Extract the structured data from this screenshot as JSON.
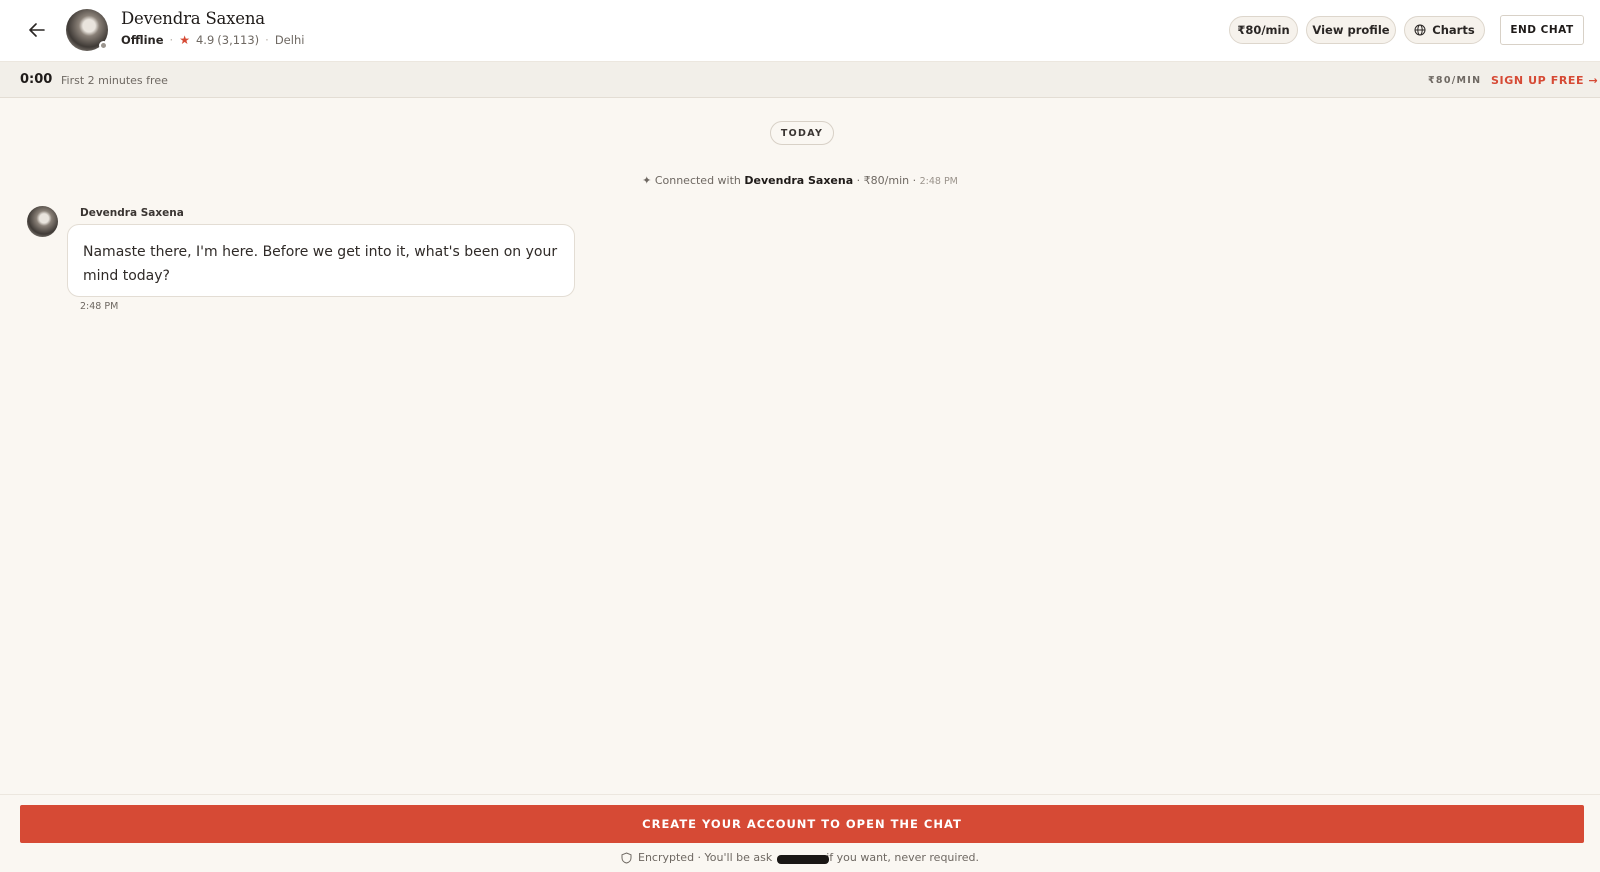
{
  "header": {
    "name": "Devendra Saxena",
    "status": "Offline",
    "rating": "4.9",
    "reviews": "(3,113)",
    "location": "Delhi",
    "rate_pill": "₹80/min",
    "view_profile": "View profile",
    "charts": "Charts",
    "end_chat": "END CHAT"
  },
  "timer_bar": {
    "timer": "0:00",
    "free_note": "First 2 minutes free",
    "rate": "₹80/MIN",
    "signup": "SIGN UP FREE →"
  },
  "chat": {
    "date_divider": "TODAY",
    "system": {
      "prefix": "✦ Connected with",
      "name": "Devendra Saxena",
      "rate": "· ₹80/min ·",
      "time": "2:48 PM"
    },
    "messages": [
      {
        "sender": "Devendra Saxena",
        "text": "Namaste there, I'm here. Before we get into it, what's been on your mind today?",
        "time": "2:48 PM"
      }
    ]
  },
  "footer": {
    "cta": "CREATE YOUR ACCOUNT TO OPEN THE CHAT",
    "note_before": "Encrypted · You'll be ask",
    "note_after": "if you want, never required."
  },
  "colors": {
    "accent": "#d64a35",
    "background": "#faf7f2",
    "header": "#ffffff",
    "timer_bar": "#f2efe9"
  }
}
